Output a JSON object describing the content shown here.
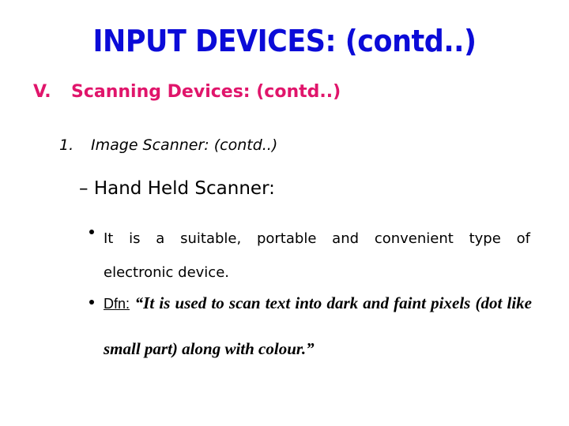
{
  "slide": {
    "title": "INPUT DEVICES: (contd..)",
    "colors": {
      "title": "#0b0bd8",
      "section_heading": "#e0156b",
      "body": "#000000"
    },
    "section": {
      "number": "V.",
      "label": "Scanning Devices: (contd..)"
    },
    "subsection": {
      "number": "1.",
      "label": "Image Scanner: (contd..)"
    },
    "topic": {
      "dash": "–",
      "label": "Hand Held Scanner:"
    },
    "bullets": [
      {
        "icon": "bullet-dot-icon",
        "line1_words": [
          "It",
          "is",
          "a",
          "suitable,",
          "portable",
          "and",
          "convenient",
          "type",
          "of"
        ],
        "line2": "electronic device."
      },
      {
        "icon": "bullet-dot-icon",
        "label": "Dfn:",
        "definition": "“It is used to scan text into dark and faint pixels (dot like small part) along with colour.”"
      }
    ]
  }
}
